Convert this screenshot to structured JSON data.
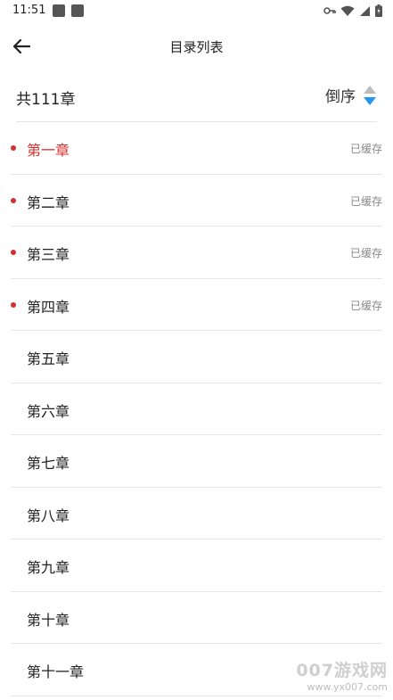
{
  "status_bar": {
    "time": "11:51"
  },
  "header": {
    "title": "目录列表"
  },
  "summary": {
    "count_label": "共111章",
    "sort_label": "倒序"
  },
  "chapters": [
    {
      "title": "第一章",
      "status": "已缓存"
    },
    {
      "title": "第二章",
      "status": "已缓存"
    },
    {
      "title": "第三章",
      "status": "已缓存"
    },
    {
      "title": "第四章",
      "status": "已缓存"
    },
    {
      "title": "第五章",
      "status": ""
    },
    {
      "title": "第六章",
      "status": ""
    },
    {
      "title": "第七章",
      "status": ""
    },
    {
      "title": "第八章",
      "status": ""
    },
    {
      "title": "第九章",
      "status": ""
    },
    {
      "title": "第十章",
      "status": ""
    },
    {
      "title": "第十一章",
      "status": ""
    }
  ],
  "watermark": {
    "brand": "007游戏网",
    "url": "www.yx007.com"
  },
  "colors": {
    "accent_red": "#d32f2f",
    "sort_arrow_active": "#2196f3",
    "sort_arrow_inactive": "#bdbdbd"
  }
}
